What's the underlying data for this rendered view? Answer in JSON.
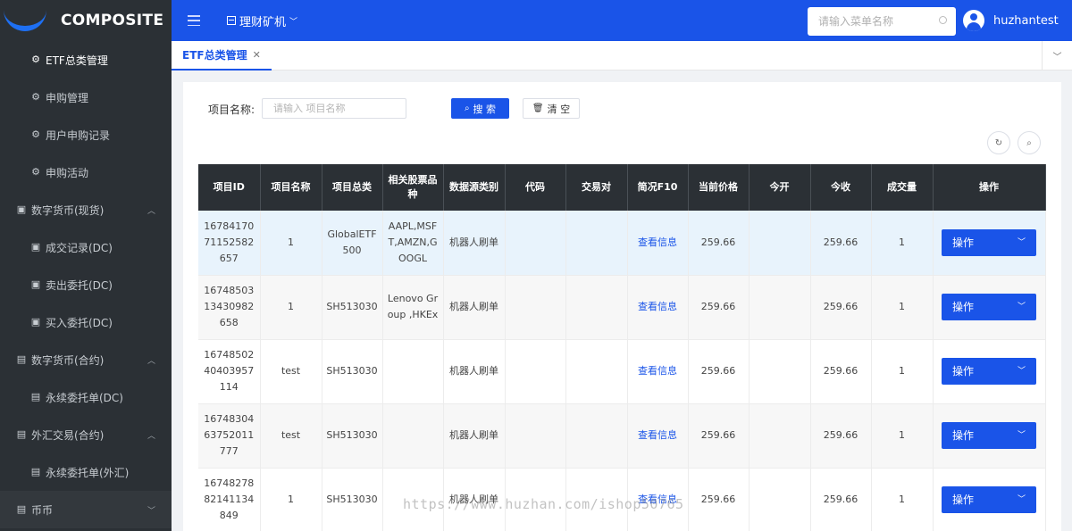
{
  "app": {
    "logo_text": "COMPOSITE"
  },
  "sidebar": {
    "items": [
      {
        "label": "ETF总类管理",
        "type": "sub",
        "icon": "gear-icon",
        "active": true
      },
      {
        "label": "申购管理",
        "type": "sub",
        "icon": "gear-icon"
      },
      {
        "label": "用户申购记录",
        "type": "sub",
        "icon": "gear-icon"
      },
      {
        "label": "申购活动",
        "type": "sub",
        "icon": "gear-icon"
      },
      {
        "label": "数字货币(现货)",
        "type": "group",
        "icon": "briefcase-icon",
        "chevron": "chevron-up-icon"
      },
      {
        "label": "成交记录(DC)",
        "type": "sub",
        "icon": "briefcase-icon"
      },
      {
        "label": "卖出委托(DC)",
        "type": "sub",
        "icon": "briefcase-icon"
      },
      {
        "label": "买入委托(DC)",
        "type": "sub",
        "icon": "briefcase-icon"
      },
      {
        "label": "数字货币(合约)",
        "type": "group",
        "icon": "document-icon",
        "chevron": "chevron-up-icon"
      },
      {
        "label": "永续委托单(DC)",
        "type": "sub",
        "icon": "list-icon"
      },
      {
        "label": "外汇交易(合约)",
        "type": "group",
        "icon": "document-icon",
        "chevron": "chevron-up-icon"
      },
      {
        "label": "永续委托单(外汇)",
        "type": "sub",
        "icon": "list-icon"
      },
      {
        "label": "币币",
        "type": "group",
        "icon": "document-icon",
        "chevron": "chevron-down-icon"
      }
    ]
  },
  "header": {
    "module_label": "理财矿机",
    "search_placeholder": "请输入菜单名称",
    "username": "huzhantest"
  },
  "tabs": [
    {
      "label": "ETF总类管理"
    }
  ],
  "filter": {
    "label": "项目名称:",
    "placeholder": "请输入 项目名称",
    "search_button": "搜 索",
    "clear_button": "清 空"
  },
  "table": {
    "columns": [
      "项目ID",
      "项目名称",
      "项目总类",
      "相关股票品种",
      "数据源类别",
      "代码",
      "交易对",
      "简况F10",
      "当前价格",
      "今开",
      "今收",
      "成交量",
      "操作"
    ],
    "rows": [
      {
        "id": "1678417071152582657",
        "name": "1",
        "category": "GlobalETF500",
        "stocks": "AAPL,MSFT,AMZN,GOOGL",
        "source": "机器人刷单",
        "code": "",
        "pair": "",
        "f10": "查看信息",
        "price": "259.66",
        "open": "",
        "close": "259.66",
        "volume": "1",
        "action": "操作"
      },
      {
        "id": "1674850313430982658",
        "name": "1",
        "category": "SH513030",
        "stocks": "Lenovo Group ,HKEx",
        "source": "机器人刷单",
        "code": "",
        "pair": "",
        "f10": "查看信息",
        "price": "259.66",
        "open": "",
        "close": "259.66",
        "volume": "1",
        "action": "操作"
      },
      {
        "id": "1674850240403957114",
        "name": "test",
        "category": "SH513030",
        "stocks": "",
        "source": "机器人刷单",
        "code": "",
        "pair": "",
        "f10": "查看信息",
        "price": "259.66",
        "open": "",
        "close": "259.66",
        "volume": "1",
        "action": "操作"
      },
      {
        "id": "1674830463752011777",
        "name": "test",
        "category": "SH513030",
        "stocks": "",
        "source": "机器人刷单",
        "code": "",
        "pair": "",
        "f10": "查看信息",
        "price": "259.66",
        "open": "",
        "close": "259.66",
        "volume": "1",
        "action": "操作"
      },
      {
        "id": "1674827882141134849",
        "name": "1",
        "category": "SH513030",
        "stocks": "",
        "source": "机器人刷单",
        "code": "",
        "pair": "",
        "f10": "查看信息",
        "price": "259.66",
        "open": "",
        "close": "259.66",
        "volume": "1",
        "action": "操作"
      }
    ]
  },
  "watermark": "https://www.huzhan.com/ishop50765",
  "colors": {
    "primary": "#1a54e8",
    "sidebar_bg": "#2b3035",
    "table_header_bg": "#2b3035",
    "highlight_row": "#e8f3fc"
  }
}
